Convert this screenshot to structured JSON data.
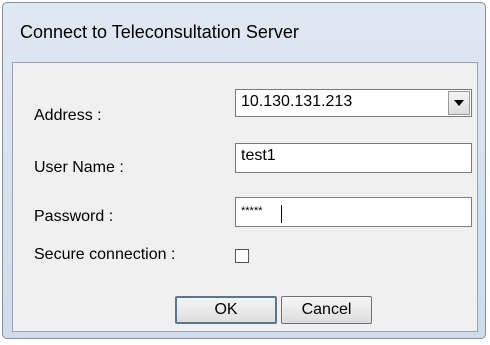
{
  "window": {
    "title": "Connect to Teleconsultation Server"
  },
  "form": {
    "address_label": "Address :",
    "address_value": "10.130.131.213",
    "username_label": "User Name :",
    "username_value": "test1",
    "password_label": "Password :",
    "password_value": "*****",
    "secure_label": "Secure connection :",
    "secure_checked": false
  },
  "buttons": {
    "ok_label": "OK",
    "cancel_label": "Cancel"
  },
  "icons": {
    "dropdown": "chevron-down-icon"
  }
}
